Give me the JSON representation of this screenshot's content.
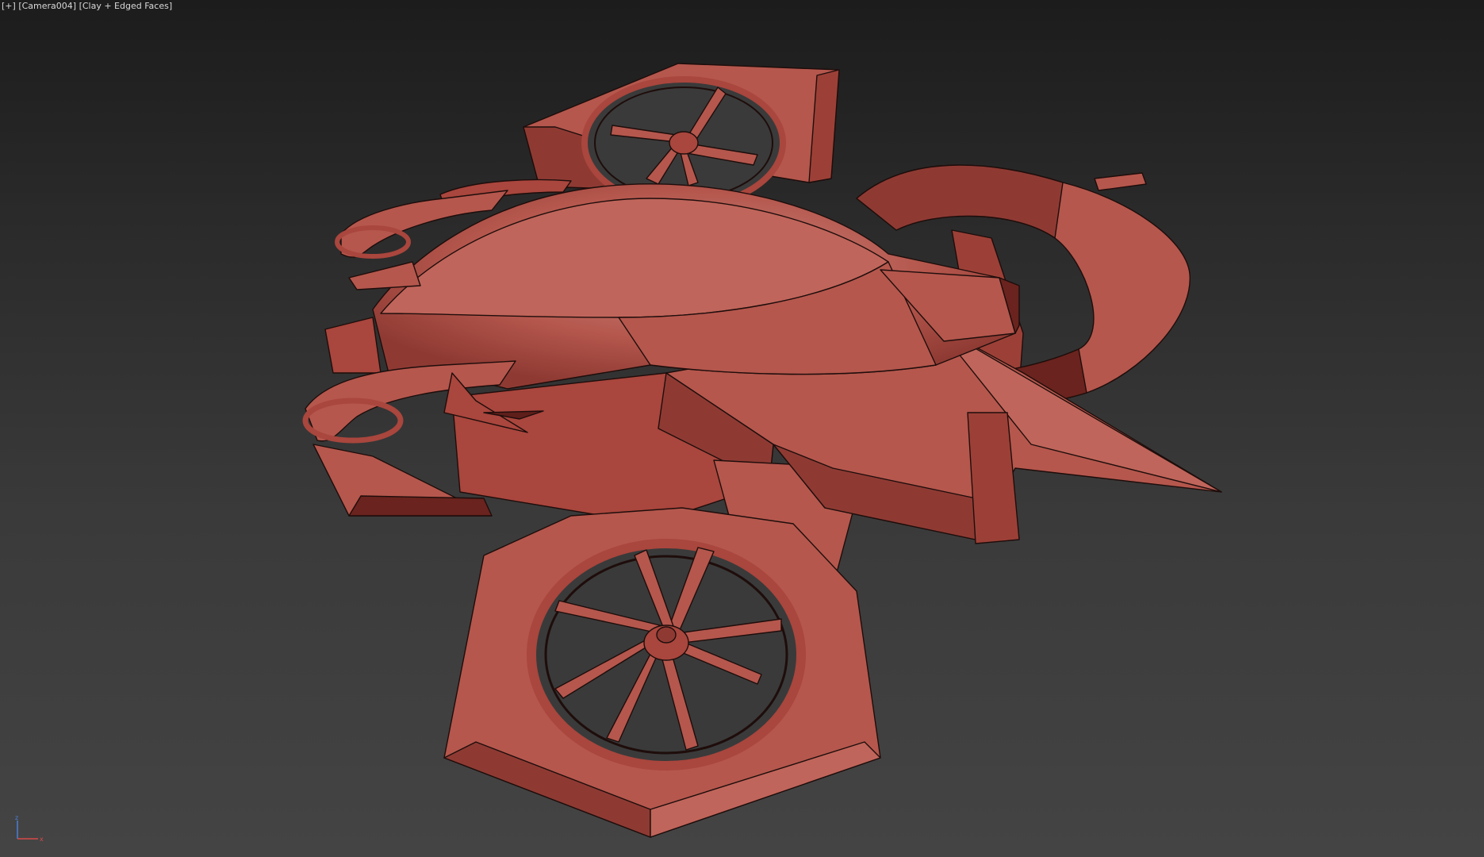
{
  "viewport": {
    "label_plus": "[+]",
    "label_camera": "[Camera004]",
    "label_shading": "[Clay + Edged Faces]",
    "axis_z": "z",
    "axis_x": "x",
    "colors": {
      "clay": "#b5574d",
      "clay_dark": "#7a2a25",
      "clay_light": "#c98078",
      "edge": "#1e0d0b",
      "background_top": "#1c1c1c",
      "background_bottom": "#444444"
    }
  }
}
